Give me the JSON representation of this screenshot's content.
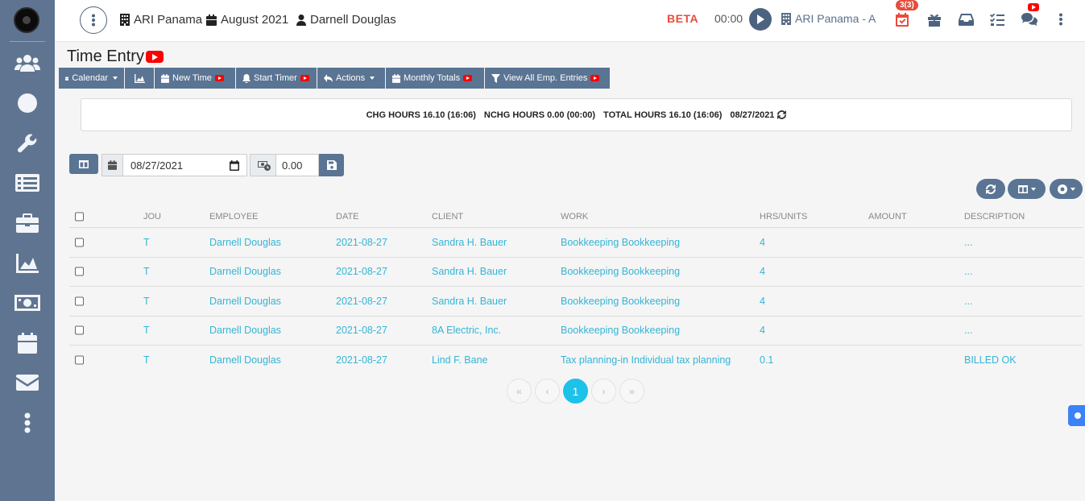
{
  "sidebar": {
    "items": [
      {
        "name": "users-icon"
      },
      {
        "name": "clock-icon"
      },
      {
        "name": "wrench-icon"
      },
      {
        "name": "list-icon"
      },
      {
        "name": "briefcase-icon"
      },
      {
        "name": "chart-icon"
      },
      {
        "name": "money-icon"
      },
      {
        "name": "calendar-icon"
      },
      {
        "name": "mail-icon"
      },
      {
        "name": "more-vertical-icon"
      }
    ]
  },
  "topbar": {
    "company": "ARI Panama",
    "period": "August 2021",
    "user": "Darnell Douglas",
    "beta": "BETA",
    "timer": "00:00",
    "company_short": "ARI Panama - A",
    "tasks_badge": "3(3)"
  },
  "page": {
    "title": "Time Entry"
  },
  "toolbar": {
    "calendar": "Calendar",
    "new_time": "New Time",
    "start_timer": "Start Timer",
    "actions": "Actions",
    "monthly_totals": "Monthly Totals",
    "view_all": "View All Emp. Entries"
  },
  "summary": {
    "chg": "CHG HOURS 16.10 (16:06)",
    "nchg": "NCHG HOURS 0.00 (00:00)",
    "total": "TOTAL HOURS 16.10 (16:06)",
    "date": "08/27/2021"
  },
  "filters": {
    "date_value": "08/27/2021",
    "hours_value": "0.00"
  },
  "table": {
    "headers": [
      "JOU",
      "EMPLOYEE",
      "DATE",
      "CLIENT",
      "WORK",
      "HRS/UNITS",
      "AMOUNT",
      "DESCRIPTION"
    ],
    "rows": [
      {
        "jou": "T",
        "employee": "Darnell Douglas",
        "date": "2021-08-27",
        "client": "Sandra H. Bauer",
        "work": "Bookkeeping Bookkeeping",
        "hrs": "4",
        "amount": "",
        "description": "..."
      },
      {
        "jou": "T",
        "employee": "Darnell Douglas",
        "date": "2021-08-27",
        "client": "Sandra H. Bauer",
        "work": "Bookkeeping Bookkeeping",
        "hrs": "4",
        "amount": "",
        "description": "..."
      },
      {
        "jou": "T",
        "employee": "Darnell Douglas",
        "date": "2021-08-27",
        "client": "Sandra H. Bauer",
        "work": "Bookkeeping Bookkeeping",
        "hrs": "4",
        "amount": "",
        "description": "..."
      },
      {
        "jou": "T",
        "employee": "Darnell Douglas",
        "date": "2021-08-27",
        "client": "8A Electric, Inc.",
        "work": "Bookkeeping Bookkeeping",
        "hrs": "4",
        "amount": "",
        "description": "..."
      },
      {
        "jou": "T",
        "employee": "Darnell Douglas",
        "date": "2021-08-27",
        "client": "Lind F. Bane",
        "work": "Tax planning-in Individual tax planning",
        "hrs": "0.1",
        "amount": "",
        "description": "BILLED OK"
      }
    ]
  },
  "pagination": {
    "first": "«",
    "prev": "‹",
    "current": "1",
    "next": "›",
    "last": "»"
  },
  "colors": {
    "sidebar": "#5f7490",
    "button": "#5a7493",
    "link": "#33b5d6",
    "accent_red": "#e74c3c",
    "page_active": "#1cc2e8"
  }
}
